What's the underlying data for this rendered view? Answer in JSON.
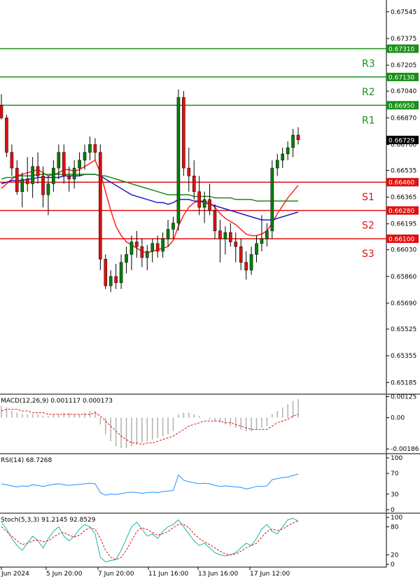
{
  "chart_data": {
    "type": "candlestick",
    "price_axis": {
      "ylim": [
        0.65115,
        0.6762
      ],
      "ticks": [
        "0.67545",
        "0.67375",
        "0.67205",
        "0.67040",
        "0.66870",
        "0.66700",
        "0.66535",
        "0.66365",
        "0.66195",
        "0.66030",
        "0.65860",
        "0.65690",
        "0.65525",
        "0.65355",
        "0.65185"
      ]
    },
    "levels": [
      {
        "id": "R3",
        "label": "R3",
        "value": "0.67310",
        "price": 0.6731,
        "color": "#1a8f1a"
      },
      {
        "id": "R2",
        "label": "R2",
        "value": "0.67130",
        "price": 0.6713,
        "color": "#1a8f1a"
      },
      {
        "id": "R1",
        "label": "R1",
        "value": "0.66950",
        "price": 0.6695,
        "color": "#1a8f1a"
      },
      {
        "id": "S1",
        "label": "S1",
        "value": "0.66460",
        "price": 0.6646,
        "color": "#e01010"
      },
      {
        "id": "S2",
        "label": "S2",
        "value": "0.66280",
        "price": 0.6628,
        "color": "#e01010"
      },
      {
        "id": "S3",
        "label": "S3",
        "value": "0.66100",
        "price": 0.661,
        "color": "#e01010"
      }
    ],
    "current_price": {
      "value": "0.66729",
      "price": 0.66729
    },
    "candles": [
      [
        0.6695,
        0.6702,
        0.6686,
        0.6687
      ],
      [
        0.6687,
        0.6689,
        0.6662,
        0.6665
      ],
      [
        0.6665,
        0.667,
        0.665,
        0.6655
      ],
      [
        0.6655,
        0.666,
        0.6638,
        0.664
      ],
      [
        0.664,
        0.6652,
        0.663,
        0.6648
      ],
      [
        0.6648,
        0.6662,
        0.664,
        0.6645
      ],
      [
        0.6645,
        0.6662,
        0.6636,
        0.6656
      ],
      [
        0.6656,
        0.6665,
        0.6645,
        0.665
      ],
      [
        0.665,
        0.6656,
        0.663,
        0.6638
      ],
      [
        0.6638,
        0.665,
        0.6625,
        0.6645
      ],
      [
        0.6645,
        0.666,
        0.664,
        0.6655
      ],
      [
        0.6655,
        0.667,
        0.6648,
        0.6665
      ],
      [
        0.6665,
        0.667,
        0.6645,
        0.665
      ],
      [
        0.665,
        0.6656,
        0.664,
        0.6648
      ],
      [
        0.6648,
        0.666,
        0.6642,
        0.6655
      ],
      [
        0.6655,
        0.6665,
        0.665,
        0.666
      ],
      [
        0.666,
        0.667,
        0.6654,
        0.6665
      ],
      [
        0.6665,
        0.6675,
        0.666,
        0.667
      ],
      [
        0.667,
        0.6674,
        0.666,
        0.6665
      ],
      [
        0.6665,
        0.667,
        0.659,
        0.6597
      ],
      [
        0.6597,
        0.66,
        0.6578,
        0.658
      ],
      [
        0.658,
        0.659,
        0.6576,
        0.6586
      ],
      [
        0.6586,
        0.6594,
        0.6578,
        0.6582
      ],
      [
        0.6582,
        0.66,
        0.6578,
        0.6595
      ],
      [
        0.6595,
        0.6605,
        0.6588,
        0.66
      ],
      [
        0.66,
        0.6612,
        0.659,
        0.6608
      ],
      [
        0.6608,
        0.6615,
        0.6598,
        0.6605
      ],
      [
        0.6605,
        0.661,
        0.6592,
        0.6598
      ],
      [
        0.6598,
        0.6606,
        0.659,
        0.6602
      ],
      [
        0.6602,
        0.661,
        0.6595,
        0.6607
      ],
      [
        0.6607,
        0.6612,
        0.6598,
        0.6602
      ],
      [
        0.6602,
        0.6614,
        0.6598,
        0.661
      ],
      [
        0.661,
        0.6622,
        0.6605,
        0.6616
      ],
      [
        0.6616,
        0.6624,
        0.661,
        0.662
      ],
      [
        0.662,
        0.6705,
        0.6615,
        0.67
      ],
      [
        0.67,
        0.6704,
        0.665,
        0.6655
      ],
      [
        0.6655,
        0.6668,
        0.664,
        0.665
      ],
      [
        0.665,
        0.666,
        0.6635,
        0.664
      ],
      [
        0.664,
        0.665,
        0.6625,
        0.663
      ],
      [
        0.663,
        0.664,
        0.662,
        0.6635
      ],
      [
        0.6635,
        0.6645,
        0.6625,
        0.6628
      ],
      [
        0.6628,
        0.6632,
        0.661,
        0.6615
      ],
      [
        0.6615,
        0.6622,
        0.6595,
        0.661
      ],
      [
        0.661,
        0.6618,
        0.66,
        0.6614
      ],
      [
        0.6614,
        0.662,
        0.6605,
        0.6608
      ],
      [
        0.6608,
        0.6614,
        0.6595,
        0.6605
      ],
      [
        0.6605,
        0.661,
        0.659,
        0.6595
      ],
      [
        0.6595,
        0.6602,
        0.6584,
        0.659
      ],
      [
        0.659,
        0.6605,
        0.6587,
        0.66
      ],
      [
        0.66,
        0.6612,
        0.6595,
        0.6607
      ],
      [
        0.6607,
        0.6625,
        0.6602,
        0.661
      ],
      [
        0.661,
        0.662,
        0.6605,
        0.6615
      ],
      [
        0.6615,
        0.666,
        0.661,
        0.6655
      ],
      [
        0.6655,
        0.6664,
        0.665,
        0.666
      ],
      [
        0.666,
        0.6668,
        0.6655,
        0.6664
      ],
      [
        0.6664,
        0.6672,
        0.666,
        0.6668
      ],
      [
        0.6668,
        0.668,
        0.6662,
        0.6676
      ],
      [
        0.6676,
        0.6681,
        0.667,
        0.6673
      ]
    ],
    "moving_averages": [
      {
        "id": "ma-red",
        "color": "#ff2222",
        "values": [
          0.6642,
          0.6645,
          0.6648,
          0.665,
          0.6651,
          0.6652,
          0.6653,
          0.6654,
          0.6652,
          0.665,
          0.6651,
          0.6652,
          0.6654,
          0.6654,
          0.6653,
          0.6654,
          0.6656,
          0.6658,
          0.666,
          0.6652,
          0.664,
          0.6628,
          0.6618,
          0.6612,
          0.6608,
          0.6606,
          0.6604,
          0.6602,
          0.6601,
          0.6602,
          0.6603,
          0.6604,
          0.6605,
          0.6609,
          0.6618,
          0.6625,
          0.663,
          0.6633,
          0.6634,
          0.6634,
          0.6633,
          0.663,
          0.6626,
          0.6623,
          0.6621,
          0.6619,
          0.6616,
          0.6613,
          0.6612,
          0.6612,
          0.6613,
          0.6615,
          0.662,
          0.6626,
          0.6631,
          0.6636,
          0.664,
          0.6644
        ]
      },
      {
        "id": "ma-blue",
        "color": "#1a1acc",
        "values": [
          0.6645,
          0.6646,
          0.6647,
          0.6647,
          0.6647,
          0.6648,
          0.6648,
          0.6649,
          0.6649,
          0.6649,
          0.6649,
          0.6649,
          0.665,
          0.665,
          0.665,
          0.665,
          0.6651,
          0.6651,
          0.6651,
          0.665,
          0.6648,
          0.6646,
          0.6644,
          0.6642,
          0.664,
          0.6638,
          0.6637,
          0.6636,
          0.6635,
          0.6634,
          0.6633,
          0.6633,
          0.6632,
          0.6633,
          0.6635,
          0.6635,
          0.6635,
          0.6634,
          0.6634,
          0.6633,
          0.6632,
          0.6631,
          0.663,
          0.6629,
          0.6628,
          0.6627,
          0.6626,
          0.6625,
          0.6624,
          0.6623,
          0.6622,
          0.6622,
          0.6622,
          0.6623,
          0.6624,
          0.6625,
          0.6626,
          0.6627
        ]
      },
      {
        "id": "ma-green",
        "color": "#1a8a1a",
        "values": [
          0.6648,
          0.6649,
          0.6649,
          0.665,
          0.665,
          0.665,
          0.665,
          0.6651,
          0.6651,
          0.6651,
          0.6651,
          0.6651,
          0.6651,
          0.6651,
          0.6651,
          0.6651,
          0.6651,
          0.6651,
          0.6651,
          0.665,
          0.665,
          0.6649,
          0.6648,
          0.6647,
          0.6646,
          0.6645,
          0.6644,
          0.6643,
          0.6642,
          0.6641,
          0.664,
          0.6639,
          0.6638,
          0.6638,
          0.6638,
          0.6638,
          0.6638,
          0.6637,
          0.6637,
          0.6637,
          0.6637,
          0.6636,
          0.6636,
          0.6636,
          0.6636,
          0.6635,
          0.6635,
          0.6635,
          0.6635,
          0.6634,
          0.6634,
          0.6634,
          0.6634,
          0.6634,
          0.6634,
          0.6634,
          0.6634,
          0.6634
        ]
      }
    ],
    "macd": {
      "label": "MACD(12,26,9) 0.001117 0.000173",
      "ylim": [
        -0.0021,
        0.0014
      ],
      "ticks": [
        "0.00125",
        "0.00",
        "-0.00186"
      ],
      "hist": [
        0.0007,
        0.0006,
        0.0004,
        0.0003,
        0.0002,
        0.0002,
        0.0002,
        0.0002,
        0.0001,
        0.0001,
        0.0002,
        0.0002,
        0.0003,
        0.0003,
        0.0002,
        0.0002,
        0.0003,
        0.0004,
        0.0004,
        -0.0004,
        -0.001,
        -0.0014,
        -0.0017,
        -0.0018,
        -0.0018,
        -0.0017,
        -0.0016,
        -0.0015,
        -0.0014,
        -0.0013,
        -0.0012,
        -0.0011,
        -0.001,
        -0.0008,
        0.0002,
        0.0003,
        0.0003,
        0.0002,
        0.0001,
        0.0,
        -0.0001,
        -0.0002,
        -0.0003,
        -0.0004,
        -0.0005,
        -0.0006,
        -0.0007,
        -0.0008,
        -0.0008,
        -0.0007,
        -0.0006,
        -0.0005,
        0.0002,
        0.0004,
        0.0006,
        0.0008,
        0.001,
        0.0011
      ],
      "signal": [
        0.0004,
        0.0005,
        0.0005,
        0.0005,
        0.0004,
        0.0004,
        0.0003,
        0.0003,
        0.0003,
        0.0002,
        0.0002,
        0.0002,
        0.0002,
        0.0002,
        0.0002,
        0.0002,
        0.0002,
        0.0002,
        0.0003,
        0.0001,
        -0.0002,
        -0.0005,
        -0.0008,
        -0.0011,
        -0.0013,
        -0.0015,
        -0.0015,
        -0.0016,
        -0.0015,
        -0.0015,
        -0.0014,
        -0.0013,
        -0.0012,
        -0.0011,
        -0.0009,
        -0.0007,
        -0.0005,
        -0.0004,
        -0.0003,
        -0.0002,
        -0.0002,
        -0.0002,
        -0.0002,
        -0.0003,
        -0.0003,
        -0.0004,
        -0.0005,
        -0.0006,
        -0.0007,
        -0.0007,
        -0.0007,
        -0.0007,
        -0.0005,
        -0.0003,
        -0.0002,
        -0.0001,
        0.0001,
        0.0002
      ]
    },
    "rsi": {
      "label": "RSI(14) 68.7268",
      "ylim": [
        0,
        100
      ],
      "ticks": [
        "100",
        "70",
        "30",
        "0"
      ],
      "values": [
        50,
        48,
        46,
        44,
        46,
        45,
        48,
        47,
        45,
        47,
        49,
        50,
        48,
        47,
        48,
        49,
        50,
        51,
        50,
        33,
        28,
        30,
        29,
        31,
        33,
        34,
        33,
        32,
        33,
        34,
        33,
        35,
        36,
        37,
        67,
        57,
        54,
        52,
        50,
        51,
        50,
        47,
        45,
        46,
        45,
        44,
        43,
        40,
        42,
        45,
        45,
        46,
        58,
        60,
        62,
        63,
        66,
        68.7
      ]
    },
    "stoch": {
      "label": "Stoch(5,3,3) 91.2145 92.8529",
      "ylim": [
        0,
        100
      ],
      "ticks": [
        "100",
        "80",
        "20",
        "0"
      ],
      "k": [
        90,
        75,
        55,
        40,
        30,
        45,
        60,
        50,
        35,
        55,
        70,
        80,
        60,
        50,
        60,
        75,
        85,
        80,
        65,
        15,
        5,
        8,
        10,
        30,
        55,
        80,
        90,
        75,
        60,
        65,
        55,
        70,
        80,
        85,
        95,
        80,
        65,
        50,
        40,
        45,
        35,
        25,
        20,
        18,
        20,
        25,
        35,
        45,
        40,
        55,
        75,
        85,
        70,
        65,
        80,
        95,
        98,
        92
      ],
      "d": [
        80,
        70,
        60,
        50,
        42,
        45,
        50,
        52,
        48,
        50,
        58,
        65,
        68,
        62,
        58,
        62,
        72,
        78,
        75,
        55,
        30,
        15,
        10,
        15,
        30,
        50,
        70,
        78,
        74,
        68,
        62,
        65,
        70,
        78,
        85,
        85,
        78,
        65,
        55,
        48,
        42,
        35,
        28,
        22,
        20,
        22,
        28,
        35,
        40,
        45,
        58,
        70,
        75,
        72,
        75,
        82,
        88,
        92.8
      ]
    },
    "x_axis": {
      "labels": [
        "Jun 2024",
        "5 Jun 20:00",
        "7 Jun 20:00",
        "11 Jun 16:00",
        "13 Jun 16:00",
        "17 Jun 12:00"
      ]
    }
  }
}
